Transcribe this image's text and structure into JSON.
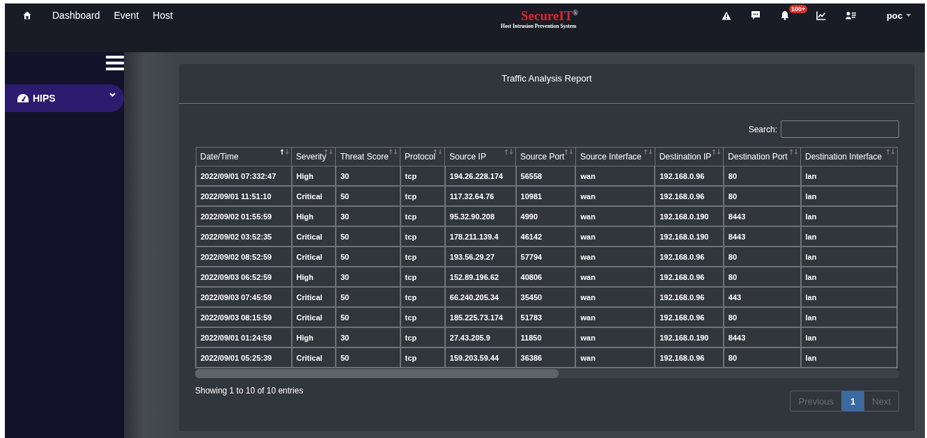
{
  "nav": {
    "links": [
      {
        "label": "Dashboard"
      },
      {
        "label": "Event"
      },
      {
        "label": "Host"
      }
    ]
  },
  "logo": {
    "title": "SecureIT$^{®}$",
    "subtitle": "Host Intrusion Prevention System"
  },
  "notifications": {
    "badge": "100+"
  },
  "user": {
    "name": "poc"
  },
  "sidebar": {
    "items": [
      {
        "label": "HIPS",
        "selected": true,
        "expanded": false
      }
    ]
  },
  "report": {
    "title": "Traffic Analysis Report",
    "search": {
      "label": "Search:"
    },
    "table": {
      "columns": [
        {
          "label": "Date/Time",
          "sorted": true
        },
        {
          "label": "Severity",
          "sorted": false
        },
        {
          "label": "Threat Score",
          "sorted": false
        },
        {
          "label": "Protocol",
          "sorted": false
        },
        {
          "label": "Source IP",
          "sorted": false
        },
        {
          "label": "Source Port",
          "sorted": false
        },
        {
          "label": "Source Interface",
          "sorted": false
        },
        {
          "label": "Destination IP",
          "sorted": false
        },
        {
          "label": "Destination Port",
          "sorted": false
        },
        {
          "label": "Destination Interface",
          "sorted": false
        }
      ],
      "rows": [
        [
          "2022/09/01 07:332:47",
          "High",
          "30",
          "tcp",
          "194.26.228.174",
          "56558",
          "wan",
          "192.168.0.96",
          "80",
          "lan"
        ],
        [
          "2022/09/01 11:51:10",
          "Critical",
          "50",
          "tcp",
          "117.32.64.76",
          "10981",
          "wan",
          "192.168.0.96",
          "80",
          "lan"
        ],
        [
          "2022/09/02 01:55:59",
          "High",
          "30",
          "tcp",
          "95.32.90.208",
          "4990",
          "wan",
          "192.168.0.190",
          "8443",
          "lan"
        ],
        [
          "2022/09/02 03:52:35",
          "Critical",
          "50",
          "tcp",
          "178.211.139.4",
          "46142",
          "wan",
          "192.168.0.190",
          "8443",
          "lan"
        ],
        [
          "2022/09/02 08:52:59",
          "Critical",
          "50",
          "tcp",
          "193.56.29.27",
          "57794",
          "wan",
          "192.168.0.96",
          "80",
          "lan"
        ],
        [
          "2022/09/03 06:52:59",
          "High",
          "30",
          "tcp",
          "152.89.196.62",
          "40806",
          "wan",
          "192.168.0.96",
          "80",
          "lan"
        ],
        [
          "2022/09/03 07:45:59",
          "Critical",
          "50",
          "tcp",
          "66.240.205.34",
          "35450",
          "wan",
          "192.168.0.96",
          "443",
          "lan"
        ],
        [
          "2022/09/03 08:15:59",
          "Critical",
          "50",
          "tcp",
          "185.225.73.174",
          "51783",
          "wan",
          "192.168.0.96",
          "80",
          "lan"
        ],
        [
          "2022/09/01 01:24:59",
          "High",
          "30",
          "tcp",
          "27.43.205.9",
          "11850",
          "wan",
          "192.168.0.190",
          "8443",
          "lan"
        ],
        [
          "2022/09/01 05:25:39",
          "Critical",
          "50",
          "tcp",
          "159.203.59.44",
          "36386",
          "wan",
          "192.168.0.96",
          "80",
          "lan"
        ]
      ]
    },
    "info": "Showing 1 to 10 of 10 entries",
    "pagination": [
      {
        "label": "Previous",
        "kind": "nav",
        "disabled": true,
        "selected": false
      },
      {
        "label": "1",
        "kind": "page",
        "disabled": false,
        "selected": true
      },
      {
        "label": "Next",
        "kind": "nav",
        "disabled": true,
        "selected": false
      }
    ]
  }
}
